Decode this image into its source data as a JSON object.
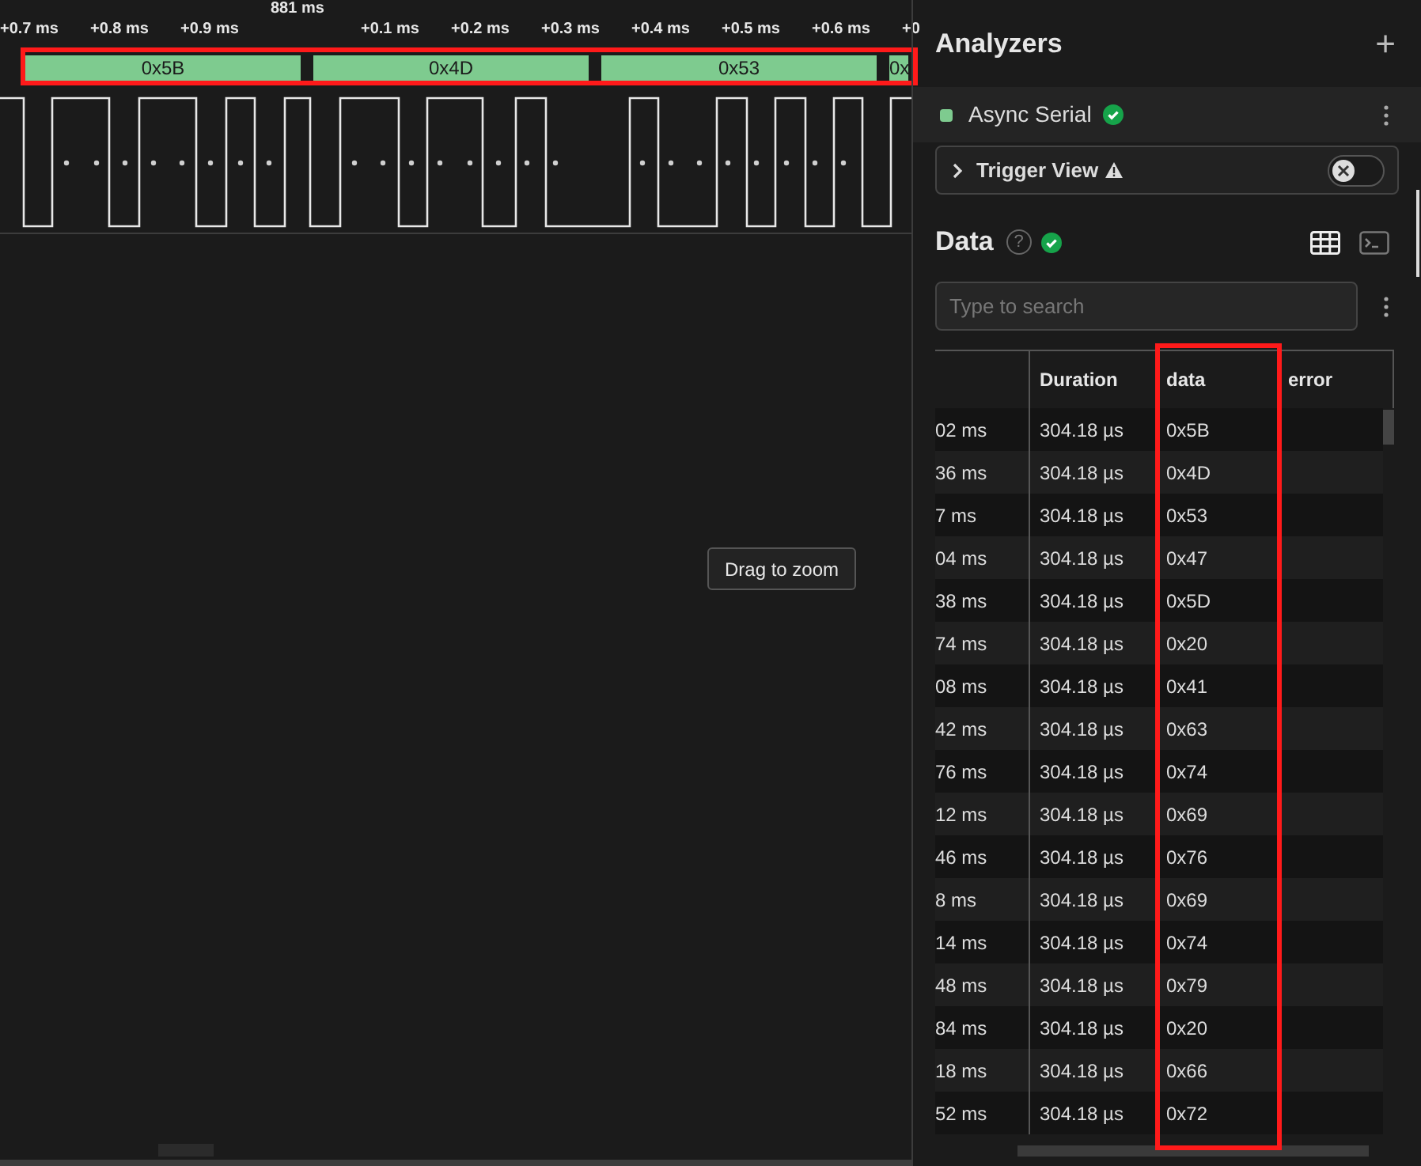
{
  "timeline": {
    "ticks": [
      {
        "label": "+0.7 ms",
        "kind": "minor"
      },
      {
        "label": "+0.8 ms",
        "kind": "minor"
      },
      {
        "label": "+0.9 ms",
        "kind": "minor"
      },
      {
        "label": "881 ms",
        "kind": "major"
      },
      {
        "label": "+0.1 ms",
        "kind": "minor"
      },
      {
        "label": "+0.2 ms",
        "kind": "minor"
      },
      {
        "label": "+0.3 ms",
        "kind": "minor"
      },
      {
        "label": "+0.4 ms",
        "kind": "minor"
      },
      {
        "label": "+0.5 ms",
        "kind": "minor"
      },
      {
        "label": "+0.6 ms",
        "kind": "minor"
      },
      {
        "label": "+0",
        "kind": "minor"
      }
    ],
    "frames": [
      "0x5B",
      "0x4D",
      "0x53",
      "0x"
    ],
    "tooltip": "Drag to zoom"
  },
  "analyzers": {
    "title": "Analyzers",
    "add": "+",
    "items": [
      {
        "name": "Async Serial",
        "color": "#7ecb8f"
      }
    ]
  },
  "trigger_view": {
    "label": "Trigger View",
    "on": false
  },
  "data": {
    "title": "Data",
    "help": "?",
    "search": {
      "placeholder": "Type to search"
    },
    "columns": [
      "",
      "Duration",
      "data",
      "error"
    ],
    "rows": [
      {
        "column_1": "02 ms",
        "duration": "304.18 µs",
        "data": "0x5B"
      },
      {
        "column_1": "36 ms",
        "duration": "304.18 µs",
        "data": "0x4D"
      },
      {
        "column_1": "7 ms",
        "duration": "304.18 µs",
        "data": "0x53"
      },
      {
        "column_1": "04 ms",
        "duration": "304.18 µs",
        "data": "0x47"
      },
      {
        "column_1": "38 ms",
        "duration": "304.18 µs",
        "data": "0x5D"
      },
      {
        "column_1": "74 ms",
        "duration": "304.18 µs",
        "data": "0x20"
      },
      {
        "column_1": "08 ms",
        "duration": "304.18 µs",
        "data": "0x41"
      },
      {
        "column_1": "42 ms",
        "duration": "304.18 µs",
        "data": "0x63"
      },
      {
        "column_1": "76 ms",
        "duration": "304.18 µs",
        "data": "0x74"
      },
      {
        "column_1": "12 ms",
        "duration": "304.18 µs",
        "data": "0x69"
      },
      {
        "column_1": "46 ms",
        "duration": "304.18 µs",
        "data": "0x76"
      },
      {
        "column_1": "8 ms",
        "duration": "304.18 µs",
        "data": "0x69"
      },
      {
        "column_1": "14 ms",
        "duration": "304.18 µs",
        "data": "0x74"
      },
      {
        "column_1": "48 ms",
        "duration": "304.18 µs",
        "data": "0x79"
      },
      {
        "column_1": "84 ms",
        "duration": "304.18 µs",
        "data": "0x20"
      },
      {
        "column_1": "18 ms",
        "duration": "304.18 µs",
        "data": "0x66"
      },
      {
        "column_1": "52 ms",
        "duration": "304.18 µs",
        "data": "0x72"
      }
    ]
  }
}
